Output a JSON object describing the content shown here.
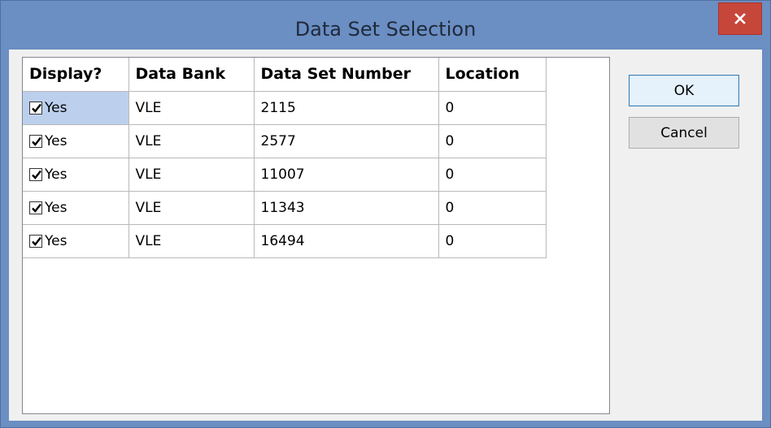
{
  "window": {
    "title": "Data Set Selection",
    "close_icon": "close-icon"
  },
  "table": {
    "columns": [
      "Display?",
      "Data Bank",
      "Data Set Number",
      "Location"
    ],
    "rows": [
      {
        "display": "Yes",
        "checked": true,
        "data_bank": "VLE",
        "data_set_number": "2115",
        "location": "0"
      },
      {
        "display": "Yes",
        "checked": true,
        "data_bank": "VLE",
        "data_set_number": "2577",
        "location": "0"
      },
      {
        "display": "Yes",
        "checked": true,
        "data_bank": "VLE",
        "data_set_number": "11007",
        "location": "0"
      },
      {
        "display": "Yes",
        "checked": true,
        "data_bank": "VLE",
        "data_set_number": "11343",
        "location": "0"
      },
      {
        "display": "Yes",
        "checked": true,
        "data_bank": "VLE",
        "data_set_number": "16494",
        "location": "0"
      }
    ]
  },
  "buttons": {
    "ok_label": "OK",
    "cancel_label": "Cancel"
  },
  "colors": {
    "title_bar": "#6b8ec3",
    "close_button": "#c7463a",
    "selected_cell": "#bcd0ee"
  }
}
